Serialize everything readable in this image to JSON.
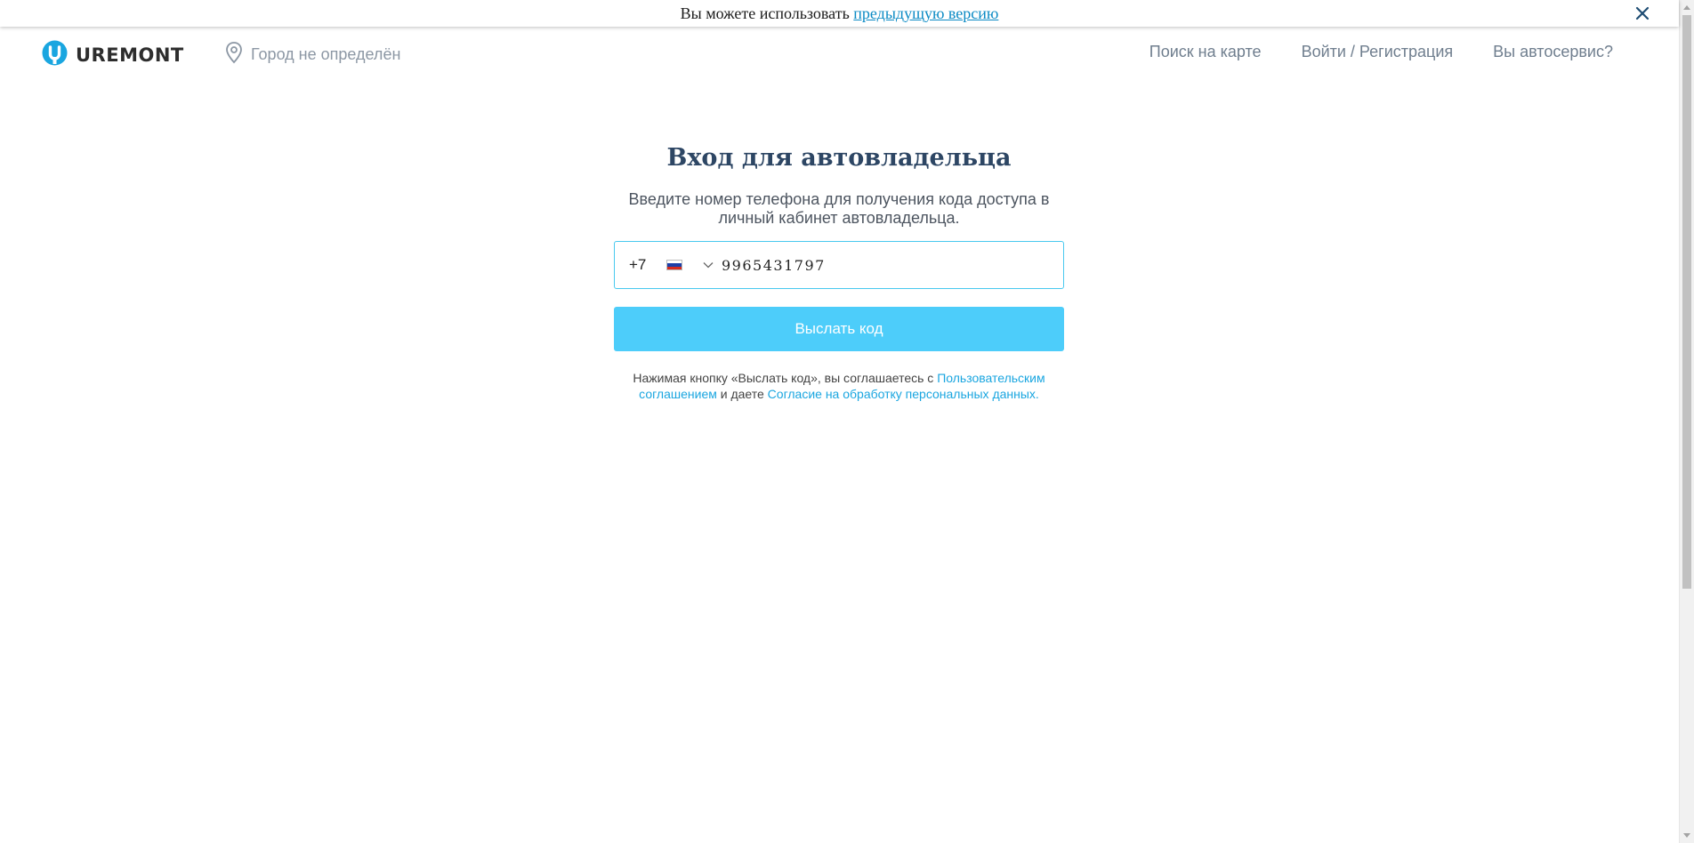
{
  "notice": {
    "text": "Вы можете использовать",
    "link": "предыдущую версию"
  },
  "header": {
    "logo_text": "UREMONT",
    "city": "Город не определён",
    "nav": {
      "map": "Поиск на карте",
      "login": "Войти / Регистрация",
      "service": "Вы автосервис?"
    }
  },
  "login": {
    "title": "Вход для автовладельца",
    "subtitle_line1": "Введите номер телефона для получения кода доступа в",
    "subtitle_line2": "личный кабинет автовладельца.",
    "country_code": "+7",
    "phone_value": "9965431797",
    "send_button": "Выслать код",
    "legal": {
      "prefix": "Нажимая кнопку «Выслать код», вы соглашаетесь с",
      "agreement_link_line1": "Пользовательским",
      "agreement_link_line2": "соглашением",
      "middle": "и даете",
      "consent_link": "Согласие на обработку персональных данных."
    }
  },
  "colors": {
    "accent": "#4dcdfa",
    "title": "#2d4664",
    "link": "#1aa6e0"
  },
  "icons": {
    "logo": "wrench-circle-icon",
    "city": "location-pin-icon",
    "close": "close-icon",
    "chevron": "chevron-down-icon",
    "flag": "russia-flag-icon"
  }
}
